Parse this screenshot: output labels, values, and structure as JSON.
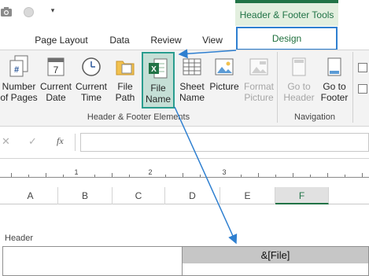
{
  "contextual_header": {
    "label": "Header & Footer Tools"
  },
  "tabs": [
    {
      "label": "Page Layout"
    },
    {
      "label": "Data"
    },
    {
      "label": "Review"
    },
    {
      "label": "View"
    },
    {
      "label": "Design",
      "selected": true
    }
  ],
  "ribbon": {
    "buttons": [
      {
        "line1": "Number",
        "line2": "of Pages",
        "icon": "number-of-pages-icon"
      },
      {
        "line1": "Current",
        "line2": "Date",
        "icon": "calendar-icon"
      },
      {
        "line1": "Current",
        "line2": "Time",
        "icon": "clock-icon"
      },
      {
        "line1": "File",
        "line2": "Path",
        "icon": "folder-icon"
      },
      {
        "line1": "File",
        "line2": "Name",
        "icon": "excel-file-icon",
        "highlighted": true
      },
      {
        "line1": "Sheet",
        "line2": "Name",
        "icon": "sheet-grid-icon"
      },
      {
        "line1": "Picture",
        "line2": "",
        "icon": "picture-icon"
      },
      {
        "line1": "Format",
        "line2": "Picture",
        "icon": "format-picture-icon",
        "disabled": true
      },
      {
        "line1": "Go to",
        "line2": "Header",
        "icon": "go-to-header-icon",
        "disabled": true
      },
      {
        "line1": "Go to",
        "line2": "Footer",
        "icon": "go-to-footer-icon"
      }
    ],
    "groups": [
      {
        "label": "Header & Footer Elements"
      },
      {
        "label": "Navigation"
      }
    ]
  },
  "formula_bar": {
    "cancel": "✕",
    "enter": "✓",
    "fx": "fx",
    "value": ""
  },
  "ruler": {
    "marks": [
      "1",
      "2",
      "3"
    ]
  },
  "columns": [
    "A",
    "B",
    "C",
    "D",
    "E",
    "F"
  ],
  "selected_column": "F",
  "header_area": {
    "label": "Header",
    "center_text": "&[File]"
  },
  "colors": {
    "excel_green": "#217346",
    "callout_blue": "#2e7fd0",
    "highlight_teal": "#2a9d8f"
  }
}
